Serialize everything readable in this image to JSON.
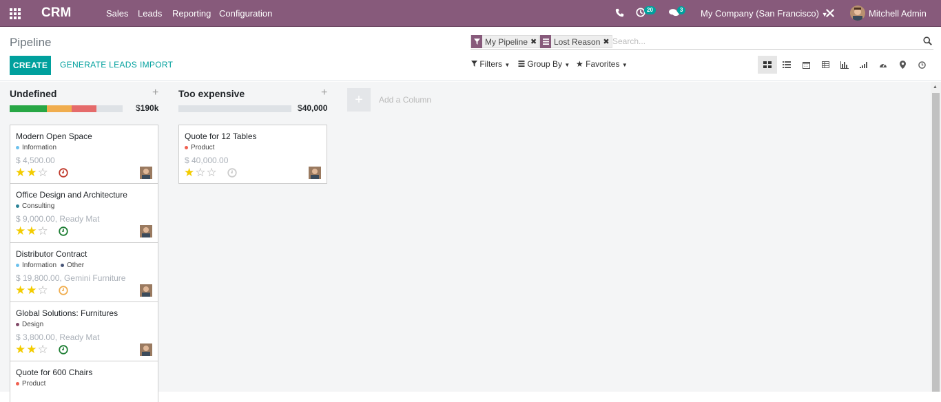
{
  "topbar": {
    "app_name": "CRM",
    "menus": [
      "Sales",
      "Leads",
      "Reporting",
      "Configuration"
    ],
    "activity_count": "20",
    "message_count": "3",
    "company": "My Company (San Francisco)",
    "user": "Mitchell Admin"
  },
  "control_panel": {
    "breadcrumb": "Pipeline",
    "create_label": "CREATE",
    "generate_leads_label": "GENERATE LEADS",
    "import_label": "IMPORT",
    "facets": [
      "My Pipeline",
      "Lost Reason"
    ],
    "search_placeholder": "Search...",
    "filters_label": "Filters",
    "group_by_label": "Group By",
    "favorites_label": "Favorites",
    "views": [
      "kanban",
      "list",
      "calendar",
      "pivot",
      "graph",
      "cohort",
      "dashboard",
      "map",
      "activity"
    ],
    "active_view": "kanban"
  },
  "columns": [
    {
      "title": "Undefined",
      "currency": "$",
      "sum": "190k",
      "progress": [
        {
          "color": "#28a745",
          "fraction": 0.33
        },
        {
          "color": "#f0ad4e",
          "fraction": 0.22
        },
        {
          "color": "#e56b6b",
          "fraction": 0.22
        },
        {
          "color": "#dee2e6",
          "fraction": 0.23
        }
      ],
      "cards": [
        {
          "title": "Modern Open Space",
          "tags": [
            {
              "label": "Information",
              "color": "#6cc1ed"
            }
          ],
          "amount": "$ 4,500.00",
          "stars": 2,
          "clock_color": "#c0392b"
        },
        {
          "title": "Office Design and Architecture",
          "tags": [
            {
              "label": "Consulting",
              "color": "#2c8397"
            }
          ],
          "amount": "$ 9,000.00, Ready Mat",
          "stars": 2,
          "clock_color": "#1e7e34"
        },
        {
          "title": "Distributor Contract",
          "tags": [
            {
              "label": "Information",
              "color": "#6cc1ed"
            },
            {
              "label": "Other",
              "color": "#475577"
            }
          ],
          "amount": "$ 19,800.00, Gemini Furniture",
          "stars": 2,
          "clock_color": "#f0ad4e"
        },
        {
          "title": "Global Solutions: Furnitures",
          "tags": [
            {
              "label": "Design",
              "color": "#814968"
            }
          ],
          "amount": "$ 3,800.00, Ready Mat",
          "stars": 2,
          "clock_color": "#1e7e34"
        },
        {
          "title": "Quote for 600 Chairs",
          "tags": [
            {
              "label": "Product",
              "color": "#f06050"
            }
          ],
          "amount": "",
          "stars": 0,
          "clock_color": ""
        }
      ]
    },
    {
      "title": "Too expensive",
      "currency": "$",
      "sum": "40,000",
      "progress": [
        {
          "color": "#dee2e6",
          "fraction": 1.0
        }
      ],
      "cards": [
        {
          "title": "Quote for 12 Tables",
          "tags": [
            {
              "label": "Product",
              "color": "#f06050"
            }
          ],
          "amount": "$ 40,000.00",
          "stars": 1,
          "clock_color": "#cccccc"
        }
      ]
    }
  ],
  "add_column_label": "Add a Column"
}
